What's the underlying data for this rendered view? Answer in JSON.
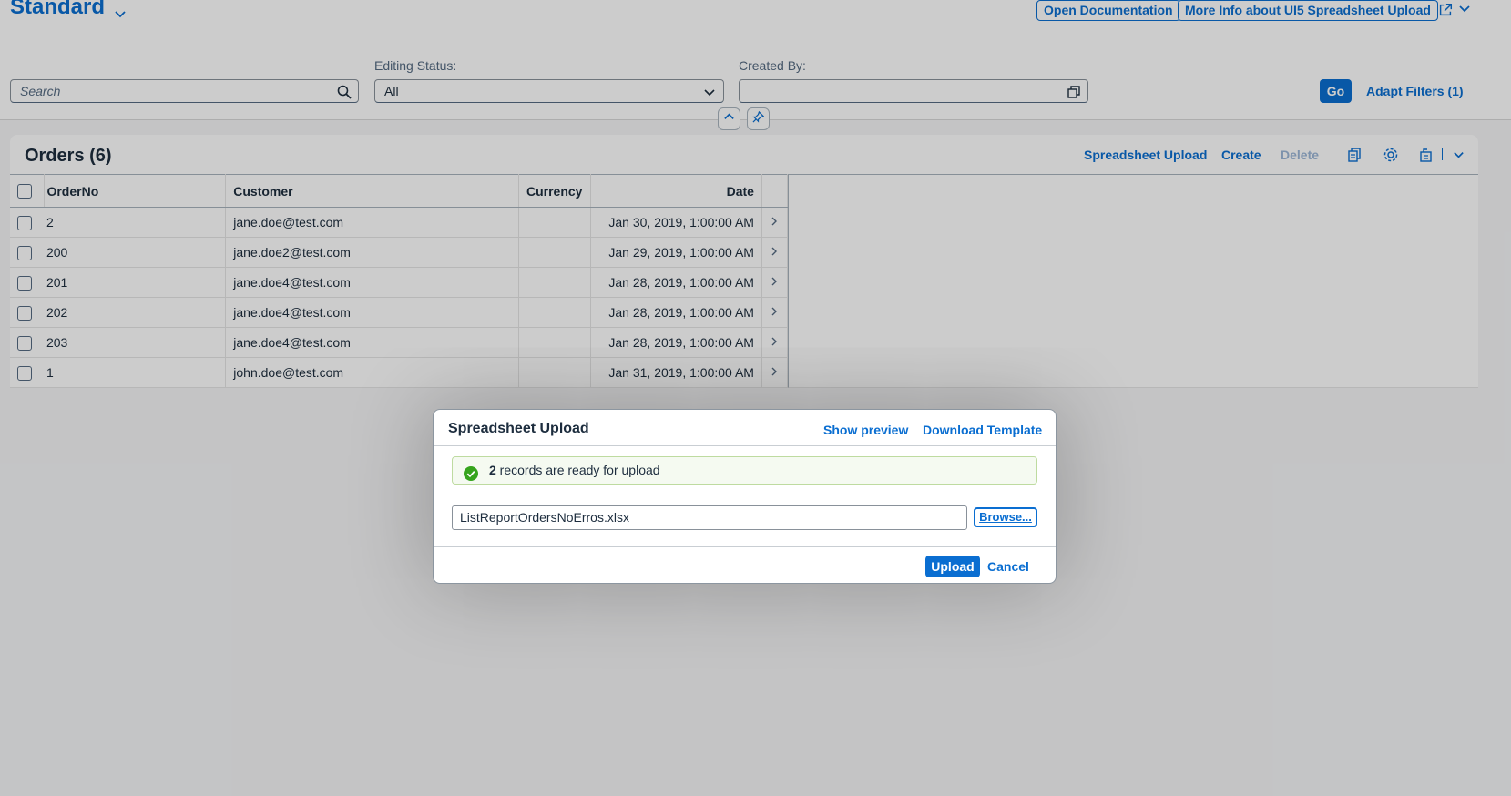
{
  "header": {
    "variant_title": "Standard",
    "open_docs_label": "Open Documentation",
    "more_info_label": "More Info about UI5 Spreadsheet Upload"
  },
  "filters": {
    "search_placeholder": "Search",
    "editing_status_label": "Editing Status:",
    "editing_status_value": "All",
    "created_by_label": "Created By:",
    "created_by_value": "",
    "go_label": "Go",
    "adapt_filters_label": "Adapt Filters (1)"
  },
  "table": {
    "title": "Orders (6)",
    "toolbar": {
      "spreadsheet_upload_label": "Spreadsheet Upload",
      "create_label": "Create",
      "delete_label": "Delete"
    },
    "columns": [
      "OrderNo",
      "Customer",
      "Currency",
      "Date"
    ],
    "rows": [
      {
        "order_no": "2",
        "customer": "jane.doe@test.com",
        "currency": "",
        "date": "Jan 30, 2019, 1:00:00 AM"
      },
      {
        "order_no": "200",
        "customer": "jane.doe2@test.com",
        "currency": "",
        "date": "Jan 29, 2019, 1:00:00 AM"
      },
      {
        "order_no": "201",
        "customer": "jane.doe4@test.com",
        "currency": "",
        "date": "Jan 28, 2019, 1:00:00 AM"
      },
      {
        "order_no": "202",
        "customer": "jane.doe4@test.com",
        "currency": "",
        "date": "Jan 28, 2019, 1:00:00 AM"
      },
      {
        "order_no": "203",
        "customer": "jane.doe4@test.com",
        "currency": "",
        "date": "Jan 28, 2019, 1:00:00 AM"
      },
      {
        "order_no": "1",
        "customer": "john.doe@test.com",
        "currency": "",
        "date": "Jan 31, 2019, 1:00:00 AM"
      }
    ]
  },
  "dialog": {
    "title": "Spreadsheet Upload",
    "show_preview_label": "Show preview",
    "download_template_label": "Download Template",
    "message_count": "2",
    "message_text": " records are ready for upload",
    "file_name": "ListReportOrdersNoErros.xlsx",
    "browse_label": "Browse...",
    "upload_label": "Upload",
    "cancel_label": "Cancel"
  },
  "colors": {
    "accent": "#0a6ed1",
    "success": "#36a41d",
    "text": "#1d2d3e"
  },
  "icons": {
    "search": "search-icon",
    "dropdown": "chevron-down-icon",
    "value_help": "value-help-icon",
    "collapse": "chevron-up-icon",
    "pin": "pin-icon",
    "copy": "copy-icon",
    "settings": "gear-icon",
    "export": "export-icon",
    "share": "share-icon",
    "success": "success-icon",
    "navigation": "chevron-right-icon"
  }
}
